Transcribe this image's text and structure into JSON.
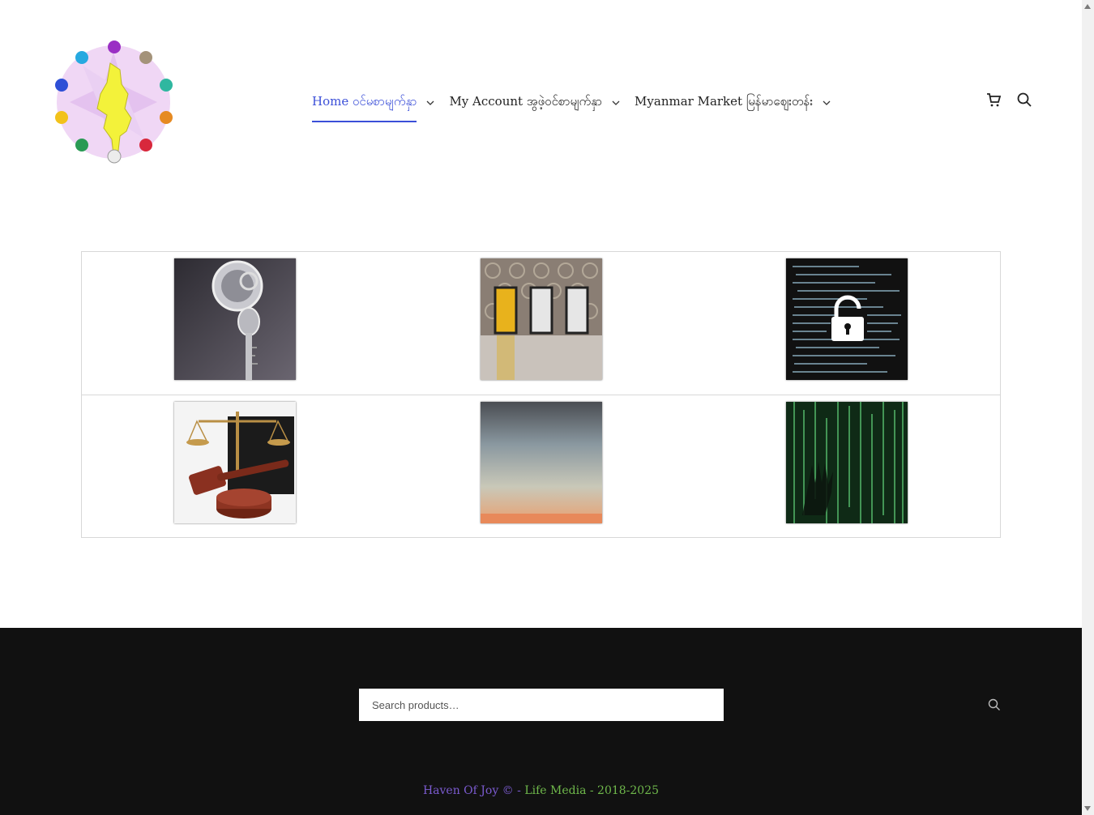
{
  "nav": {
    "items": [
      {
        "label": "Home ဝင်မစာမျက်နှာ",
        "active": true
      },
      {
        "label": "My Account အွဖဲ့ဝင်စာမျက်နှာ",
        "active": false
      },
      {
        "label": "Myanmar Market မြန်မာဈေးတန်း",
        "active": false
      }
    ]
  },
  "header": {
    "icons": [
      "cart-icon",
      "search-icon"
    ]
  },
  "grid": {
    "images": [
      "key-in-lock",
      "three-doors",
      "code-unlock",
      "scales-gavel",
      "sky-sunset",
      "matrix-hand"
    ]
  },
  "footer": {
    "search_placeholder": "Search products…",
    "copyright_a": "Haven Of Joy © - ",
    "copyright_b": "Life Media - 2018-2025"
  },
  "colors": {
    "accent": "#3b4fd8",
    "footer_bg": "#111111",
    "copyright_purple": "#7b5bd0",
    "copyright_green": "#6fb84b"
  }
}
